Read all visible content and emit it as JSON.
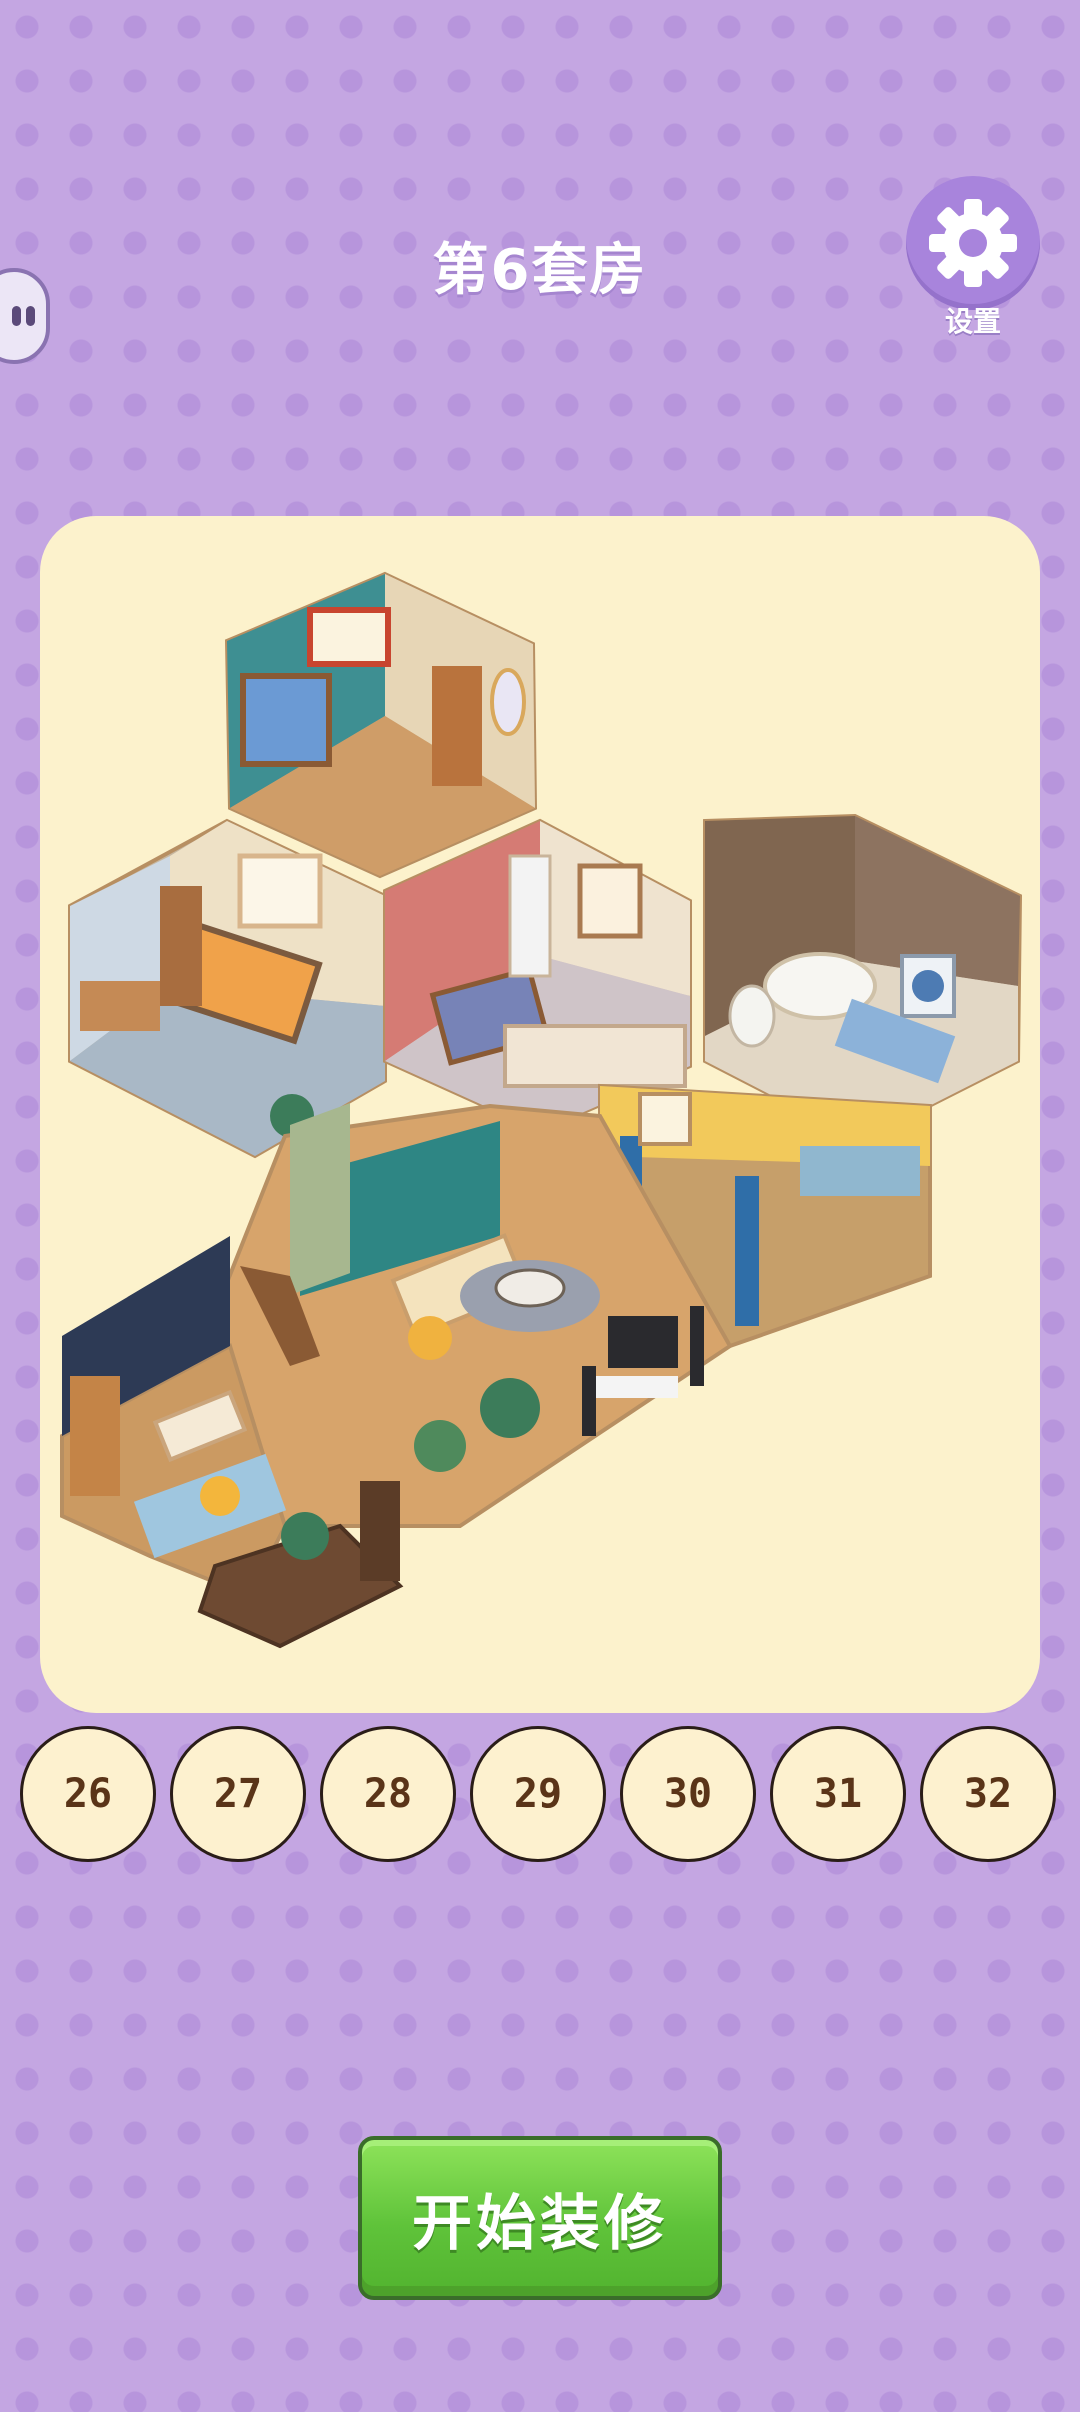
{
  "title": "第6套房",
  "settings": {
    "label": "设置",
    "icon": "gear-icon"
  },
  "left_tab": {
    "icon": "pause-face-icon"
  },
  "levels": [
    "26",
    "27",
    "28",
    "29",
    "30",
    "31",
    "32"
  ],
  "start_button": {
    "label": "开始装修"
  },
  "colors": {
    "background": "#c4a6e2",
    "panel": "#fcf2cc",
    "button_green": "#5fc33a",
    "level_text": "#5a3418"
  }
}
